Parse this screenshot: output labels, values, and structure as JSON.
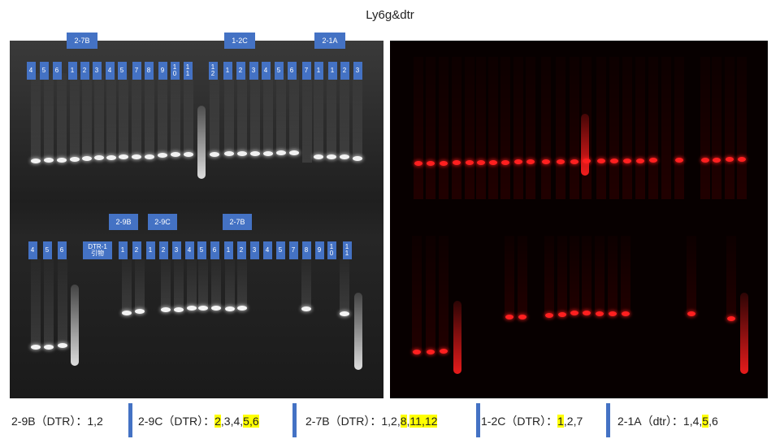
{
  "title": "Ly6g&dtr",
  "gel_left": {
    "top_groups": [
      "2-7B",
      "1-2C",
      "2-1A"
    ],
    "top_lanes": [
      "4",
      "5",
      "6",
      "1",
      "2",
      "3",
      "4",
      "5",
      "7",
      "8",
      "9",
      "10",
      "11",
      "12",
      "1",
      "2",
      "3",
      "4",
      "5",
      "6",
      "7",
      "1",
      "1",
      "2",
      "3"
    ],
    "bottom_groups": [
      "2-9B",
      "2-9C",
      "2-7B"
    ],
    "bottom_lanes": [
      "4",
      "5",
      "6",
      "DTR-1 引物",
      "1",
      "2",
      "1",
      "2",
      "3",
      "4",
      "5",
      "6",
      "1",
      "2",
      "3",
      "4",
      "5",
      "7",
      "8",
      "9",
      "10",
      "11"
    ]
  },
  "colors": {
    "label_bg": "#4472c4",
    "highlight": "#ffff00",
    "red_band": "#ff2020"
  },
  "results": [
    {
      "prefix": "2-9B（DTR）：",
      "items": [
        {
          "t": "1,2",
          "h": false
        }
      ]
    },
    {
      "prefix": "2-9C（DTR）：",
      "items": [
        {
          "t": "2",
          "h": true
        },
        {
          "t": ",3,4,",
          "h": false
        },
        {
          "t": "5,6",
          "h": true
        }
      ]
    },
    {
      "prefix": "2-7B（DTR）：",
      "items": [
        {
          "t": "1,2,",
          "h": false
        },
        {
          "t": "8",
          "h": true
        },
        {
          "t": ",",
          "h": false
        },
        {
          "t": "11,12",
          "h": true
        }
      ]
    },
    {
      "prefix": "1-2C（DTR）：",
      "items": [
        {
          "t": "1",
          "h": true
        },
        {
          "t": ",2,7",
          "h": false
        }
      ]
    },
    {
      "prefix": "2-1A（dtr）：",
      "items": [
        {
          "t": "1,4,",
          "h": false
        },
        {
          "t": "5",
          "h": true
        },
        {
          "t": ",6",
          "h": false
        }
      ]
    }
  ]
}
